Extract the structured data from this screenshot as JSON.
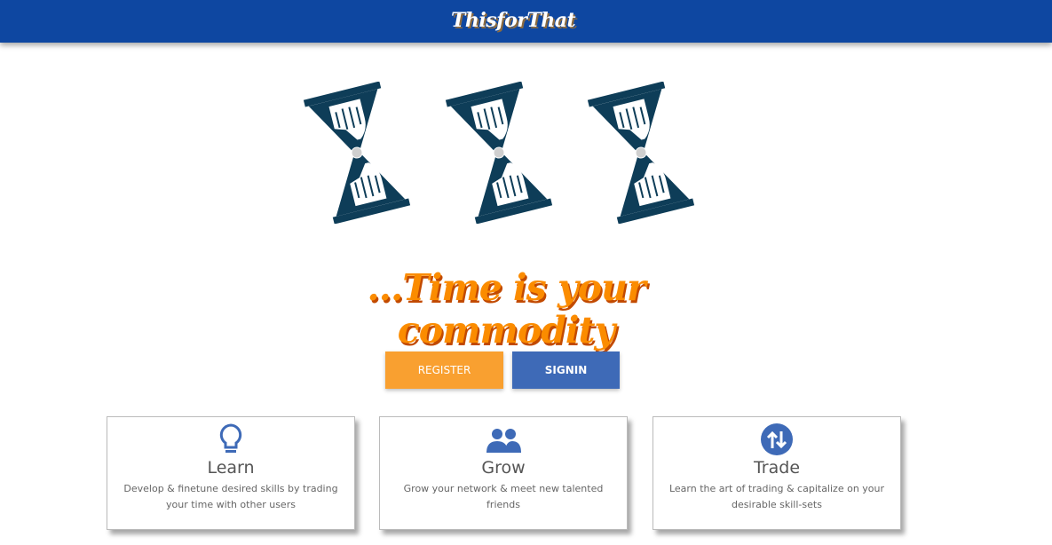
{
  "navbar": {
    "brand": "ThisforThat"
  },
  "hero": {
    "tagline": "...Time is your commodity"
  },
  "buttons": {
    "register": "REGISTER",
    "signin": "SIGNIN"
  },
  "features": [
    {
      "icon": "lightbulb-icon",
      "title": "Learn",
      "description": "Develop & finetune desired skills by trading your time with other users"
    },
    {
      "icon": "people-icon",
      "title": "Grow",
      "description": "Grow your network & meet new talented friends"
    },
    {
      "icon": "trade-arrows-icon",
      "title": "Trade",
      "description": "Learn the art of trading & capitalize on your desirable skill-sets"
    }
  ],
  "colors": {
    "navbar": "#0e47a1",
    "tagline": "#fb8c00",
    "register": "#f9a030",
    "signin": "#3e6ab7",
    "hourglass": "#0e3d58",
    "icon": "#3e6ab7"
  }
}
